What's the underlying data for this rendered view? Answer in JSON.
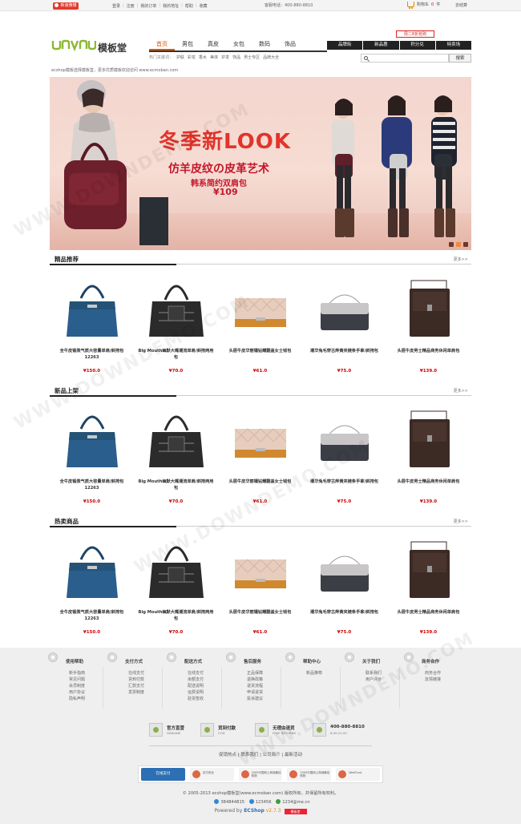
{
  "topbar": {
    "weibo": "新浪微博",
    "links": [
      "登录",
      "注册",
      "我的订单",
      "我的地址",
      "帮助",
      "收藏"
    ],
    "hotline": "客服电话：400-880-8810",
    "cart_label": "购物车",
    "cart_count": "0",
    "cart_suffix": "件",
    "checkout": "去结算"
  },
  "header": {
    "logo_text": "模板堂",
    "nav": [
      "首页",
      "男包",
      "真皮",
      "女包",
      "数码",
      "饰品"
    ],
    "promo": "周二8折抢购",
    "tabs": [
      "品牌街",
      "新品惠",
      "积分兑",
      "特卖场"
    ],
    "hot_label": "热门关键词：",
    "hot_keywords": [
      "护肤",
      "彩妆",
      "香水",
      "美体",
      "护发",
      "饰品",
      "男士专区",
      "品牌大全"
    ],
    "search_button": "搜索",
    "notice": "ecshop模板选择模板堂，更多优质模板欢迎访问 www.ecmoban.com"
  },
  "banner": {
    "title": "冬季新LOOK",
    "subtitle": "仿羊皮纹の皮革艺术",
    "desc": "韩系简约双肩包",
    "price": "¥109"
  },
  "sections": [
    {
      "title": "精品推荐",
      "more": "更多>>"
    },
    {
      "title": "新品上架",
      "more": "更多>>"
    },
    {
      "title": "热卖商品",
      "more": "更多>>"
    }
  ],
  "products": [
    {
      "name": "全牛皮锻羡气质大容量单肩/斜挎包12263",
      "price": "¥150.0",
      "color": "#2a5e8c",
      "type": "tote"
    },
    {
      "name": "Big Mouth幽默大嘴潮流单肩/斜挎两用包",
      "price": "¥70.0",
      "color": "#2b2b2b",
      "type": "duffel"
    },
    {
      "name": "头层牛皮华丽镶钻耀翻盖女士钱包",
      "price": "¥61.0",
      "color": "#e7cdbd",
      "type": "wallet"
    },
    {
      "name": "潮华兔毛穿古烨黄夹链条手拿/斜挎包",
      "price": "¥75.0",
      "color": "#3b3e44",
      "type": "clutch"
    },
    {
      "name": "头层牛皮男士精品商务休闲单肩包",
      "price": "¥139.0",
      "color": "#3c2a24",
      "type": "messenger"
    }
  ],
  "footer": {
    "help": [
      {
        "title": "使用帮助",
        "items": [
          "新手指南",
          "常见问题",
          "会员制度",
          "用户协议",
          "隐私声明"
        ]
      },
      {
        "title": "支付方式",
        "items": [
          "在线支付",
          "货到付款",
          "汇款支付",
          "发票制度"
        ]
      },
      {
        "title": "配送方式",
        "items": [
          "在线支付",
          "余额支付",
          "配送说明",
          "运费说明",
          "验货签收"
        ]
      },
      {
        "title": "售后服务",
        "items": [
          "正品保障",
          "退换政策",
          "退货流程",
          "申请退货",
          "投诉建议"
        ]
      },
      {
        "title": "帮助中心",
        "items": [
          "新品推荐"
        ]
      },
      {
        "title": "关于我们",
        "items": [
          "联系我们",
          "用户评价"
        ]
      },
      {
        "title": "商务合作",
        "items": [
          "商务合作",
          "友情链接"
        ]
      }
    ],
    "services": [
      {
        "title": "官方直营",
        "sub": "GENUINE"
      },
      {
        "title": "货到付款",
        "sub": "COD"
      },
      {
        "title": "无理由退货",
        "sub": "FREE RETURNS"
      },
      {
        "title": "400-880-8810",
        "sub": "8:00-21:00"
      }
    ],
    "links": "促销热点 | 联系我们 | 公司简介 | 最新活动",
    "badges": [
      {
        "text": "在线支付",
        "blue": true
      },
      {
        "text": "支付安全",
        "blue": false
      },
      {
        "text": "2009中国网上商城最佳购物",
        "blue": false
      },
      {
        "text": "2009中国网上商城最佳购物",
        "blue": false
      },
      {
        "text": "WebTrust",
        "blue": false
      }
    ],
    "copyright": "© 2005-2013 ecshop模板堂(www.ecmoban.com) 版权所有，并保留所有权利。",
    "qq1": "384844815",
    "qq2": "123456",
    "email": "1234@me.cn",
    "powered_prefix": "Powered by",
    "powered_brand": "ECShop",
    "powered_version": "v2.7.3",
    "powered_logo": "模板堂"
  }
}
